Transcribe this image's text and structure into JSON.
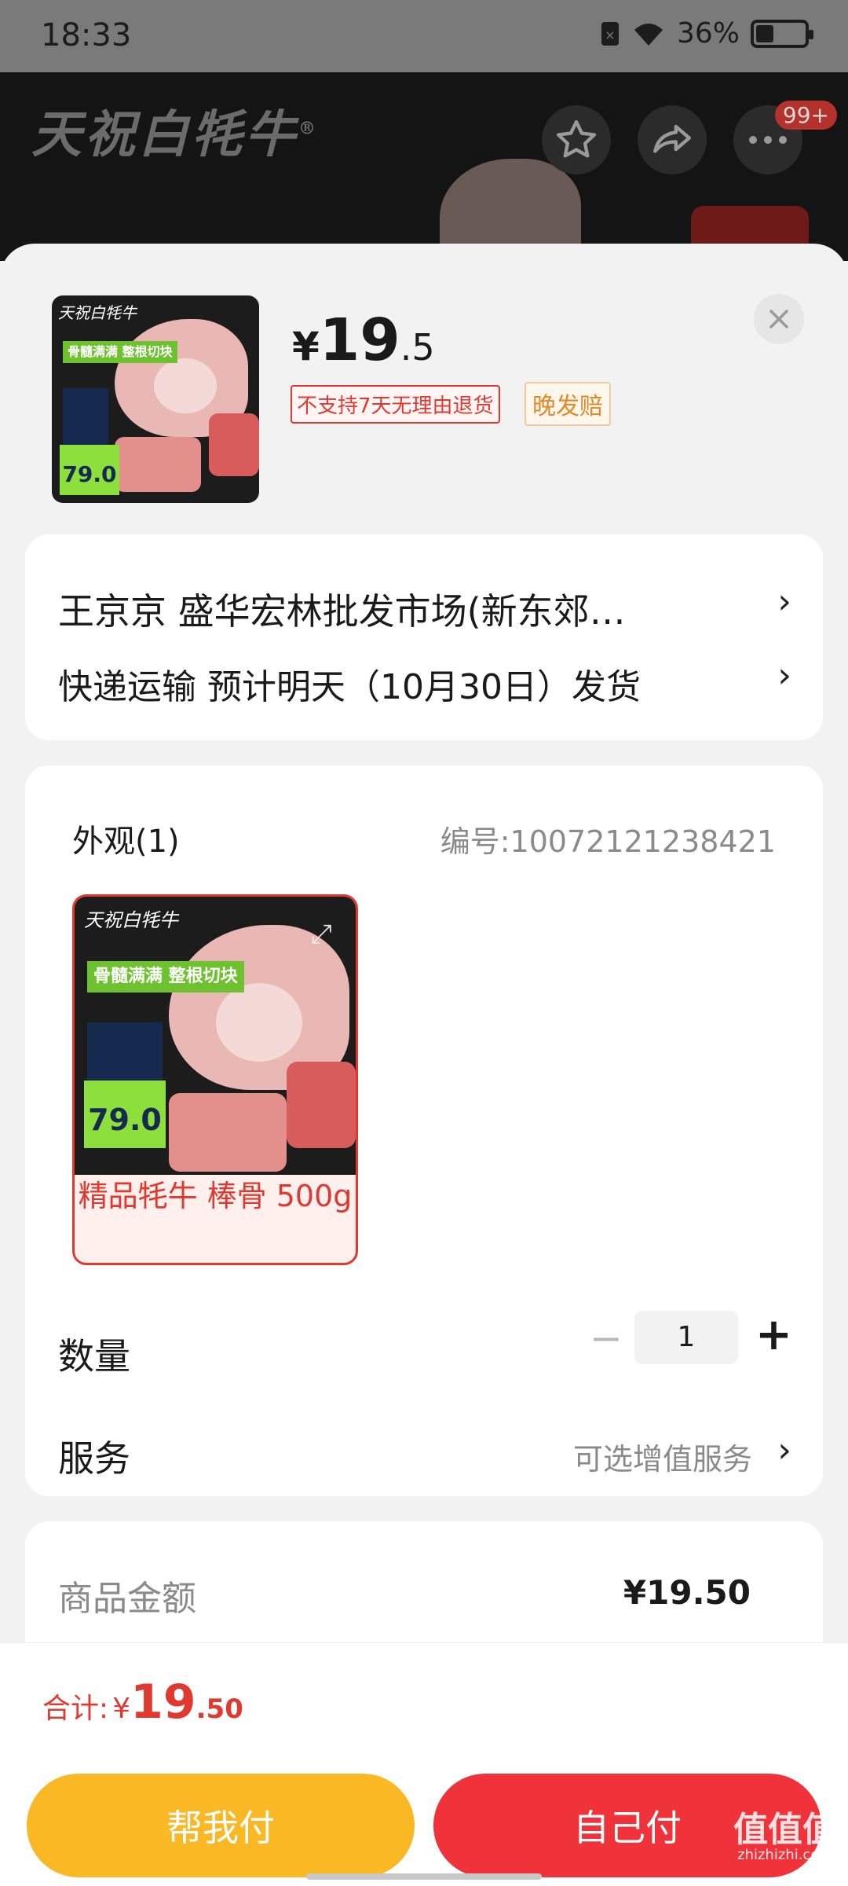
{
  "status_bar": {
    "time": "18:33",
    "battery_text": "36%",
    "battery_level": 0.36,
    "sim_icon": "sim-icon",
    "wifi_icon": "wifi-icon"
  },
  "header": {
    "brand": "天祝白牦牛",
    "brand_mark": "®",
    "cart_badge": "99+",
    "icons": [
      "star-icon",
      "share-icon",
      "more-icon"
    ]
  },
  "product": {
    "price_symbol": "¥",
    "price_int": "19",
    "price_dec": ".5",
    "tag_no_return": "不支持7天无理由退货",
    "tag_late": "晚发赔",
    "thumb_brand": "天祝白牦牛",
    "thumb_badge": "骨髓满满 整根切块",
    "thumb_price": "79.0"
  },
  "address": {
    "line": "王京京  盛华宏林批发市场(新东郊…",
    "shipping": "快递运输 预计明天（10月30日）发货"
  },
  "spec": {
    "title": "外观(1)",
    "code": "编号:10072121238421",
    "variant_label": "精品牦牛 棒骨 500g"
  },
  "quantity": {
    "label": "数量",
    "value": "1",
    "minus": "−",
    "plus": "+"
  },
  "service": {
    "label": "服务",
    "value": "可选增值服务"
  },
  "amount": {
    "label": "商品金额",
    "value": "¥19.50"
  },
  "footer": {
    "total_label": "合计:",
    "total_symbol": "¥",
    "total_int": "19",
    "total_dec": ".50",
    "help_pay": "帮我付",
    "self_pay": "自己付",
    "watermark": "值值值",
    "watermark_url": "zhizhizhi.com"
  },
  "colors": {
    "accent_red": "#e0392f",
    "pay_yellow": "#f9b824",
    "pay_red": "#f0333b"
  }
}
